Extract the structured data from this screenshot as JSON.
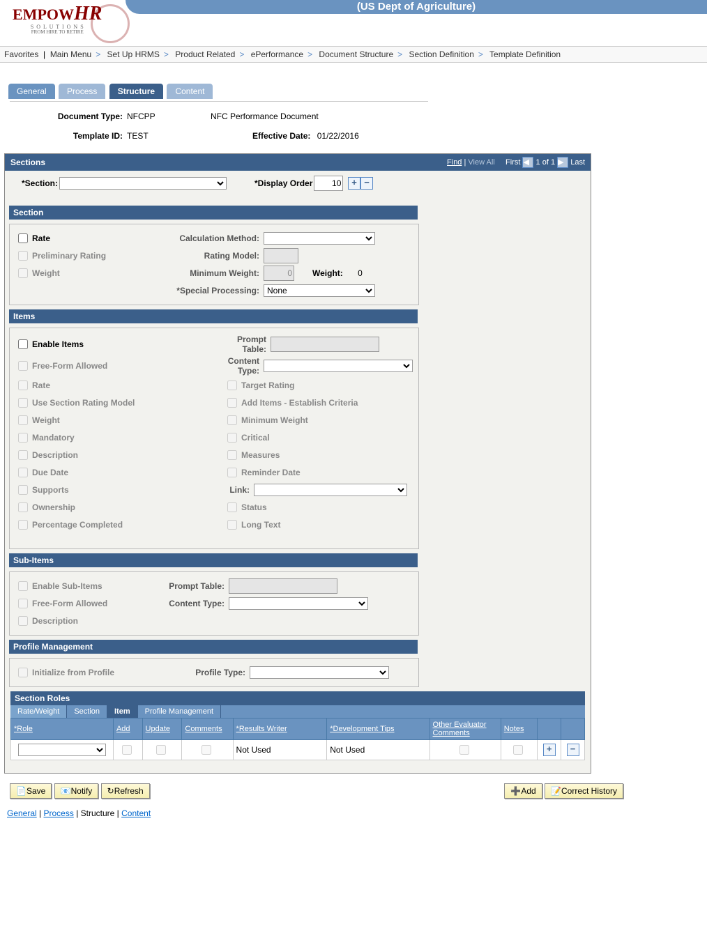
{
  "branding": {
    "title": "(US Dept of Agriculture)",
    "logo_a": "EMPOW",
    "logo_b": "HR",
    "logo_sub": "S O L U T I O N S",
    "logo_sub2": "FROM HIRE TO RETIRE"
  },
  "breadcrumb": [
    "Favorites",
    "Main Menu",
    "Set Up HRMS",
    "Product Related",
    "ePerformance",
    "Document Structure",
    "Section Definition",
    "Template Definition"
  ],
  "tabs": [
    {
      "label": "General"
    },
    {
      "label": "Process"
    },
    {
      "label": "Structure",
      "active": true
    },
    {
      "label": "Content"
    }
  ],
  "header": {
    "doc_type_lbl": "Document Type:",
    "doc_type": "NFCPP",
    "doc_desc": "NFC Performance Document",
    "template_lbl": "Template ID:",
    "template": "TEST",
    "eff_lbl": "Effective Date:",
    "eff": "01/22/2016"
  },
  "scroll": {
    "title": "Sections",
    "find": "Find",
    "viewall": "View All",
    "pager": "1 of 1",
    "first": "First",
    "last": "Last"
  },
  "section_sel": {
    "lbl": "*Section:",
    "val": "",
    "order_lbl": "*Display Order",
    "order": "10"
  },
  "section": {
    "title": "Section",
    "rate": "Rate",
    "prelim": "Preliminary Rating",
    "weight": "Weight",
    "calc_lbl": "Calculation Method:",
    "calc": "",
    "rating_model_lbl": "Rating Model:",
    "rating_model": "",
    "min_weight_lbl": "Minimum Weight:",
    "min_weight": "0",
    "weight_lbl": "Weight:",
    "weight_val": "0",
    "special_lbl": "*Special Processing:",
    "special": "None"
  },
  "items": {
    "title": "Items",
    "enable": "Enable Items",
    "freeform": "Free-Form Allowed",
    "rate": "Rate",
    "use_section_rm": "Use Section Rating Model",
    "weight": "Weight",
    "mandatory": "Mandatory",
    "description": "Description",
    "due_date": "Due Date",
    "supports": "Supports",
    "ownership": "Ownership",
    "pct": "Percentage Completed",
    "prompt_lbl": "Prompt Table:",
    "prompt": "",
    "content_type_lbl": "Content Type:",
    "content_type": "",
    "target_rating": "Target Rating",
    "add_items": "Add Items - Establish Criteria",
    "min_weight": "Minimum Weight",
    "critical": "Critical",
    "measures": "Measures",
    "reminder": "Reminder Date",
    "link_lbl": "Link:",
    "link": "",
    "status": "Status",
    "long_text": "Long Text"
  },
  "subitems": {
    "title": "Sub-Items",
    "enable": "Enable Sub-Items",
    "freeform": "Free-Form Allowed",
    "description": "Description",
    "prompt_lbl": "Prompt Table:",
    "prompt": "",
    "content_type_lbl": "Content Type:",
    "content_type": ""
  },
  "profile": {
    "title": "Profile Management",
    "init": "Initialize from Profile",
    "type_lbl": "Profile Type:",
    "type": ""
  },
  "roles": {
    "title": "Section Roles",
    "subtabs": [
      "Rate/Weight",
      "Section",
      "Item",
      "Profile Management"
    ],
    "subtab_active": "Item",
    "cols": {
      "role": "*Role",
      "add": "Add",
      "update": "Update",
      "comments": "Comments",
      "results": "*Results Writer",
      "dev": "*Development Tips",
      "other": "Other Evaluator Comments",
      "notes": "Notes"
    },
    "row": {
      "role": "",
      "results": "Not Used",
      "dev": "Not Used"
    }
  },
  "footer": {
    "save": "Save",
    "notify": "Notify",
    "refresh": "Refresh",
    "add": "Add",
    "correct": "Correct History"
  },
  "bottom_links": [
    "General",
    "Process",
    "Structure",
    "Content"
  ]
}
